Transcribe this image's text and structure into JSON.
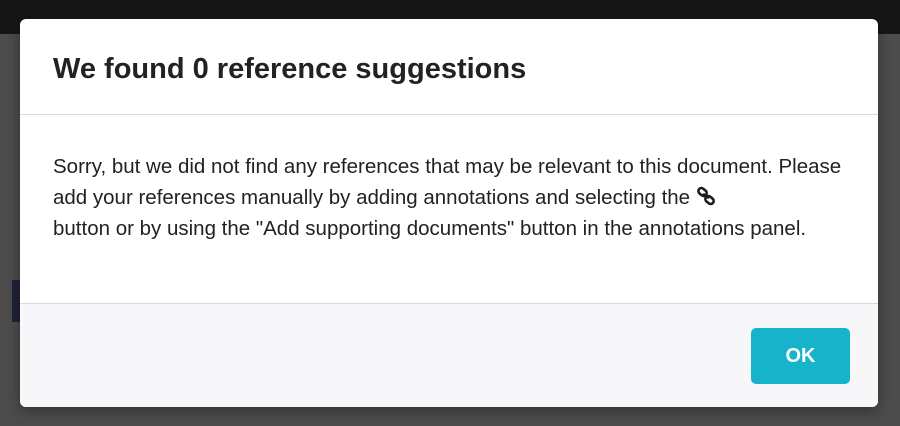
{
  "dialog": {
    "title": "We found 0 reference suggestions",
    "message_before_icon": "Sorry, but we did not find any references that may be relevant to this document. Please add your references manually by adding annotations and selecting the",
    "inline_icon": "link-icon",
    "message_after_icon": "button or by using the \"Add supporting documents\" button in the annotations panel.",
    "ok_label": "OK"
  },
  "colors": {
    "accent": "#17b3cb",
    "overlay": "#4c4c4c",
    "topbar": "#161616"
  }
}
